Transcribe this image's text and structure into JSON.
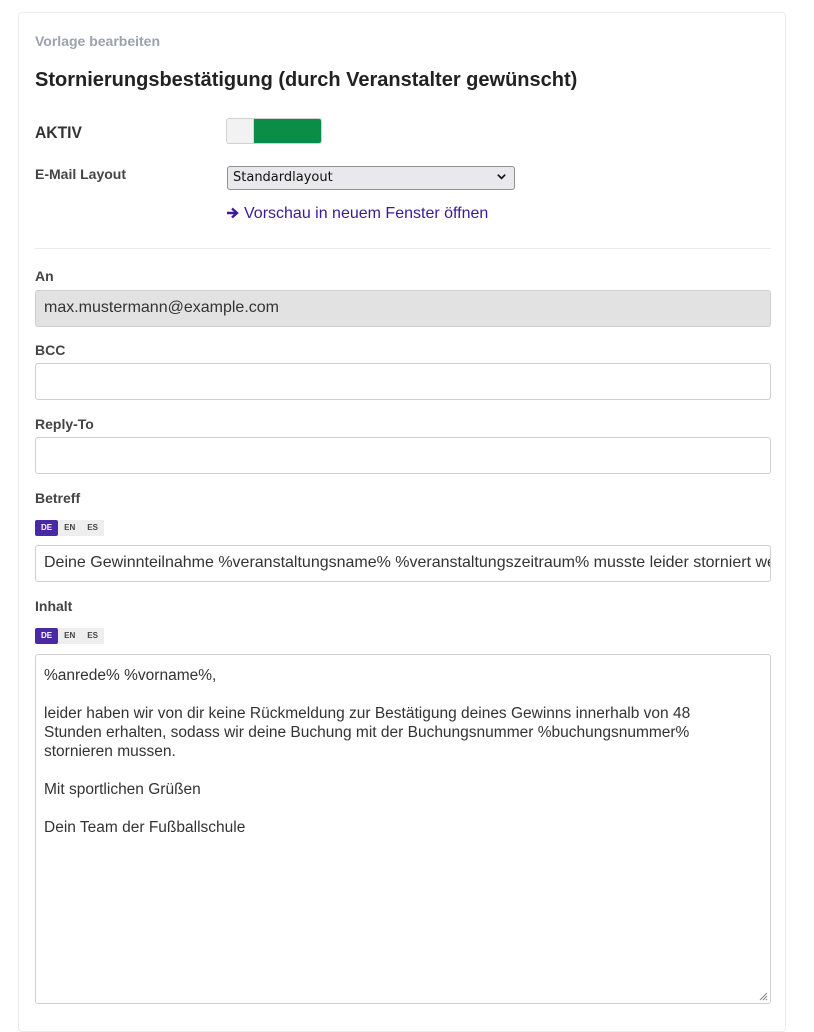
{
  "breadcrumb": "Vorlage bearbeiten",
  "title": "Stornierungsbestätigung (durch Veranstalter gewünscht)",
  "active": {
    "label": "AKTIV",
    "enabled": true,
    "color": "#0a8d47"
  },
  "layout": {
    "label": "E-Mail Layout",
    "selected": "Standardlayout"
  },
  "preview_link": "Vorschau in neuem Fenster öffnen",
  "to": {
    "label": "An",
    "value": "max.mustermann@example.com"
  },
  "bcc": {
    "label": "BCC",
    "value": ""
  },
  "reply_to": {
    "label": "Reply-To",
    "value": ""
  },
  "subject": {
    "label": "Betreff",
    "languages": [
      "DE",
      "EN",
      "ES"
    ],
    "active_language": "DE",
    "value": "Deine Gewinnteilnahme %veranstaltungsname% %veranstaltungszeitraum% musste leider storniert werden"
  },
  "content": {
    "label": "Inhalt",
    "languages": [
      "DE",
      "EN",
      "ES"
    ],
    "active_language": "DE",
    "line1": "%anrede% %vorname%,",
    "line2": "leider haben wir von dir keine Rückmeldung zur Bestätigung deines Gewinns innerhalb von 48",
    "line3": "Stunden erhalten, sodass wir deine Buchung mit der Buchungsnummer %buchungsnummer%",
    "line4": "stornieren mussen.",
    "line5": "Mit sportlichen Grüßen",
    "line6": "Dein Team der Fußballschule"
  },
  "accent_color": "#4a2aa4"
}
